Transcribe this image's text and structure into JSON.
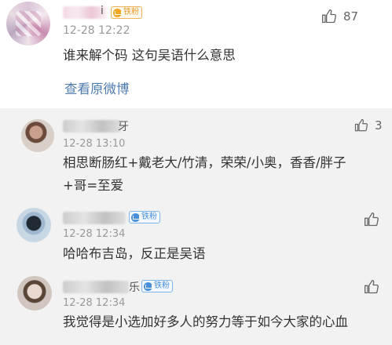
{
  "main": {
    "name_tail": "i",
    "badge": "铁粉",
    "time": "12-28 12:22",
    "text": "谁来解个码 这句吴语什么意思",
    "view_original": "查看原微博",
    "likes": "87"
  },
  "replies": [
    {
      "name_tail": "牙",
      "time": "12-28 13:10",
      "text_line1": "相思断肠红+戴老大/竹清，荣荣/小奥，香香/胖子",
      "text_line2": "+哥=至爱",
      "likes": "3"
    },
    {
      "name_tail": "",
      "badge": "铁粉",
      "time": "12-28 12:34",
      "text": "哈哈布吉岛，反正是吴语",
      "likes": ""
    },
    {
      "name_tail": "乐",
      "badge": "铁粉",
      "time": "12-28 12:34",
      "text": "我觉得是小选加好多人的努力等于如今大家的心血",
      "likes": ""
    }
  ],
  "colors": {
    "link": "#507daf",
    "badge_orange": "#e89b2a",
    "badge_blue": "#4a90d9",
    "reply_bg": "#f2f2f2"
  },
  "icons": [
    "thumbs-up-icon",
    "fan-badge-icon"
  ]
}
